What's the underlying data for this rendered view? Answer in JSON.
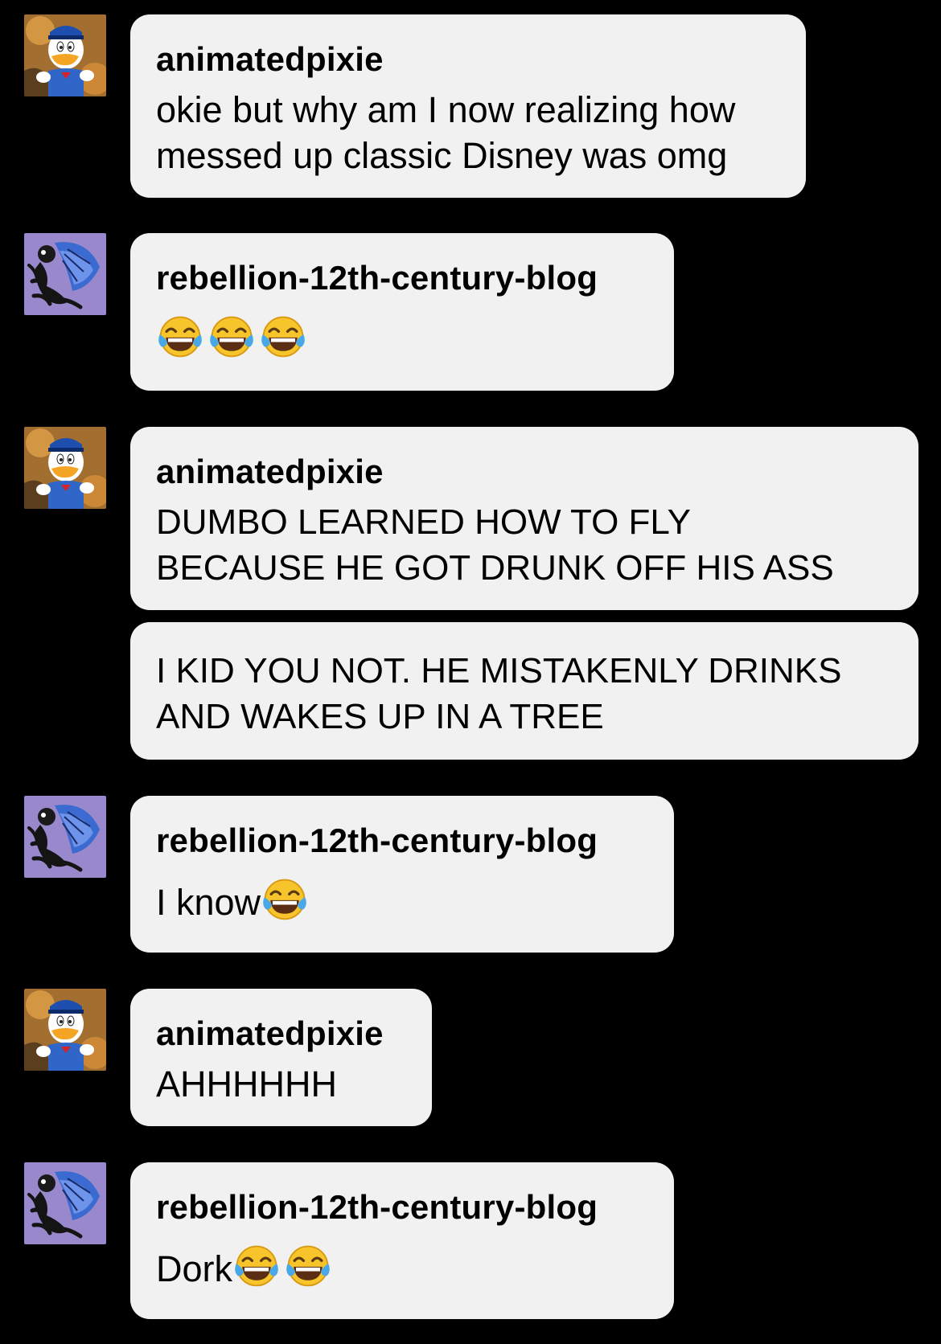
{
  "messages": [
    {
      "sender": "animatedpixie",
      "avatar": "donald-duck-avatar",
      "text": "okie but why am I now realizing how\nmessed up classic Disney was omg"
    },
    {
      "sender": "rebellion-12th-century-blog",
      "avatar": "winged-creature-avatar",
      "text": "",
      "emoji": "tears-of-joy-emoji",
      "emoji_count": 3
    },
    {
      "sender": "animatedpixie",
      "avatar": "donald-duck-avatar",
      "text": "DUMBO LEARNED HOW TO FLY\nBECAUSE HE GOT DRUNK OFF HIS ASS"
    },
    {
      "sender": "",
      "text": "I KID YOU NOT. HE MISTAKENLY DRINKS\nAND WAKES UP IN A TREE"
    },
    {
      "sender": "rebellion-12th-century-blog",
      "avatar": "winged-creature-avatar",
      "text": "I know",
      "emoji": "tears-of-joy-emoji",
      "emoji_count": 1
    },
    {
      "sender": "animatedpixie",
      "avatar": "donald-duck-avatar",
      "text": "AHHHHHH"
    },
    {
      "sender": "rebellion-12th-century-blog",
      "avatar": "winged-creature-avatar",
      "text": "Dork",
      "emoji": "tears-of-joy-emoji",
      "emoji_count": 2
    }
  ],
  "colors": {
    "background": "#000000",
    "bubble": "#f1f1f1",
    "text": "#000000"
  }
}
